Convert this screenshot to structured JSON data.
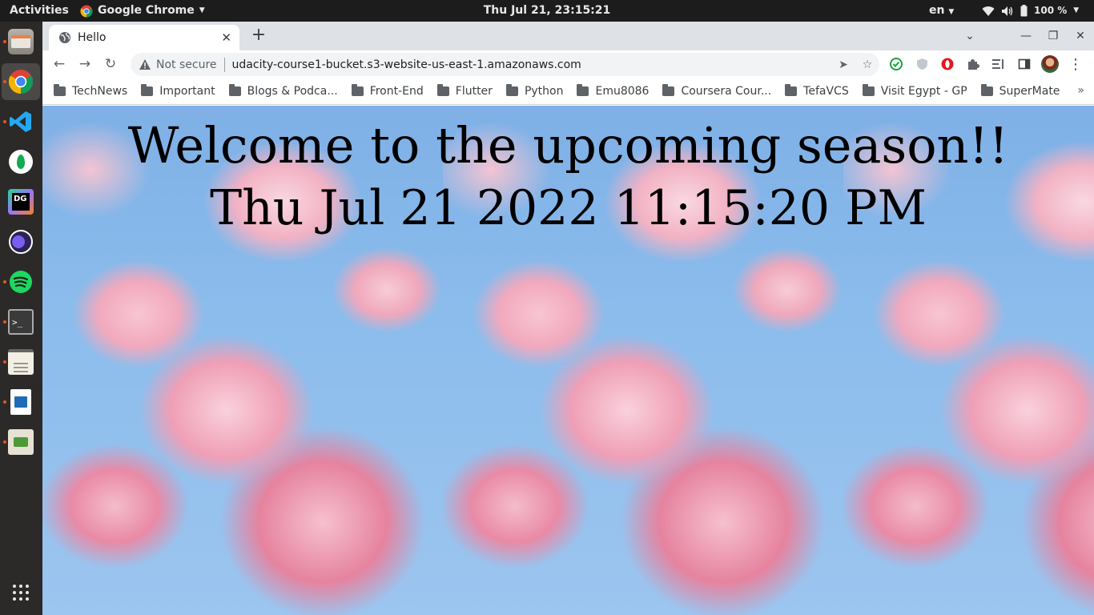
{
  "topbar": {
    "activities": "Activities",
    "app_name": "Google Chrome",
    "clock": "Thu Jul 21, 23:15:21",
    "language": "en",
    "battery": "100 %"
  },
  "dock": {
    "items": [
      {
        "icon": "files-icon"
      },
      {
        "icon": "chrome-icon",
        "active": true
      },
      {
        "icon": "vscode-icon"
      },
      {
        "icon": "mongodb-compass-icon"
      },
      {
        "icon": "datagrip-icon"
      },
      {
        "icon": "eclipse-icon"
      },
      {
        "icon": "spotify-icon"
      },
      {
        "icon": "terminal-icon"
      },
      {
        "icon": "text-editor-icon"
      },
      {
        "icon": "libreoffice-writer-icon"
      },
      {
        "icon": "system-monitor-icon"
      }
    ],
    "apps_grid": "show-applications-icon"
  },
  "browser": {
    "tab_title": "Hello",
    "address": {
      "security_label": "Not secure",
      "url": "udacity-course1-bucket.s3-website-us-east-1.amazonaws.com"
    },
    "bookmarks": [
      "TechNews",
      "Important",
      "Blogs & Podca...",
      "Front-End",
      "Flutter",
      "Python",
      "Emu8086",
      "Coursera Cour...",
      "TefaVCS",
      "Visit Egypt - GP",
      "SuperMate"
    ],
    "colors": {
      "tabstrip": "#dee1e6",
      "accent": "#1a73e8"
    }
  },
  "page": {
    "heading": "Welcome to the upcoming season!!",
    "datetime": "Thu Jul 21 2022 11:15:20 PM"
  }
}
